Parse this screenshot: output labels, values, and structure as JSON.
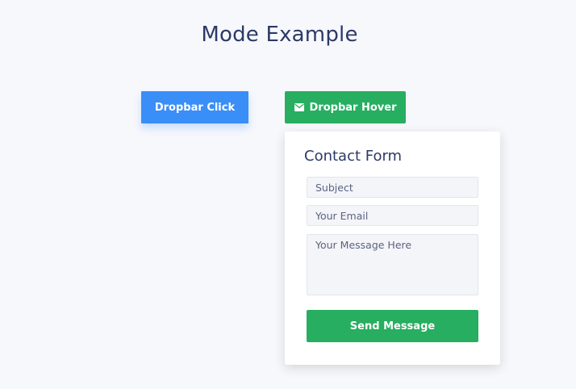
{
  "page": {
    "title": "Mode Example",
    "background": "#f7f8fc"
  },
  "buttons": {
    "click_label": "Dropbar Click",
    "hover_label": "Dropbar Hover",
    "hover_icon": "envelope-icon",
    "click_color": "#3a8ef7",
    "hover_color": "#27ae60"
  },
  "contact_form": {
    "title": "Contact Form",
    "subject_placeholder": "Subject",
    "email_placeholder": "Your Email",
    "message_placeholder": "Your Message Here",
    "send_label": "Send Message",
    "send_color": "#27ae60"
  }
}
